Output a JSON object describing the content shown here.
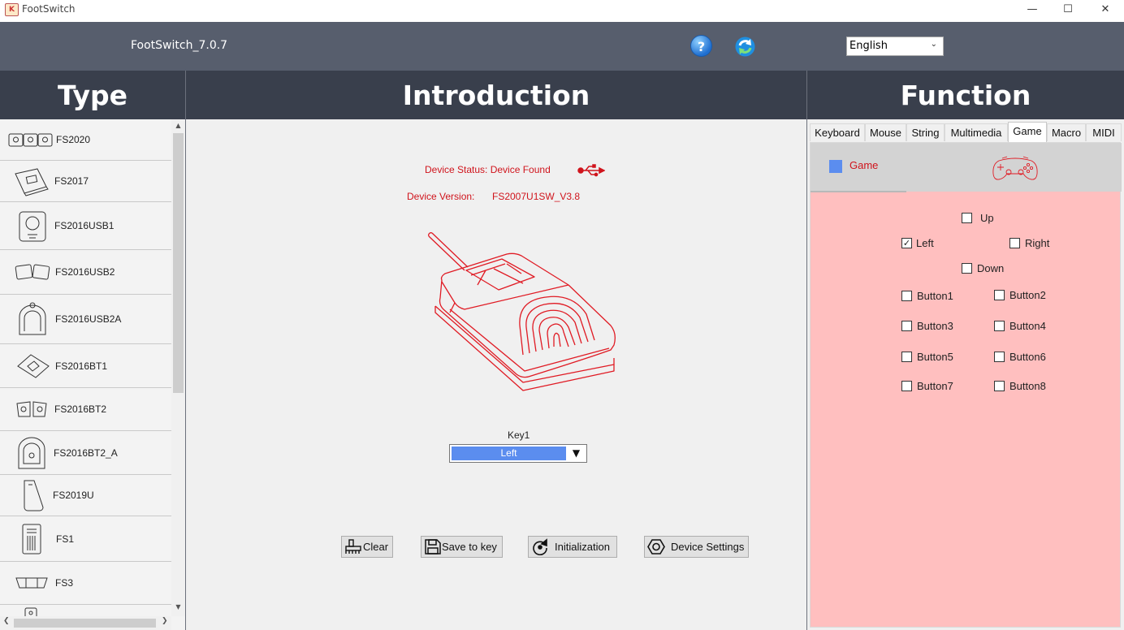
{
  "window": {
    "title": "FootSwitch",
    "app_icon_text": "K",
    "minimize": "—",
    "maximize": "☐",
    "close": "✕"
  },
  "header": {
    "version": "FootSwitch_7.0.7",
    "help_glyph": "?",
    "language": "English"
  },
  "columns": {
    "type": "Type",
    "introduction": "Introduction",
    "function": "Function"
  },
  "types": [
    "FS2020",
    "FS2017",
    "FS2016USB1",
    "FS2016USB2",
    "FS2016USB2A",
    "FS2016BT1",
    "FS2016BT2",
    "FS2016BT2_A",
    "FS2019U",
    "FS1",
    "FS3"
  ],
  "device": {
    "status": "Device Status: Device Found",
    "version_label": "Device Version:",
    "version_value": "FS2007U1SW_V3.8"
  },
  "key": {
    "label": "Key1",
    "value": "Left",
    "arrow": "▼"
  },
  "actions": {
    "clear": "Clear",
    "save": "Save to key",
    "init": "Initialization",
    "settings": "Device Settings"
  },
  "tabs": [
    "Keyboard",
    "Mouse",
    "String",
    "Multimedia",
    "Game",
    "Macro",
    "MIDI"
  ],
  "active_tab": "Game",
  "game": {
    "title": "Game",
    "options": {
      "up": {
        "label": "Up",
        "checked": false
      },
      "left": {
        "label": "Left",
        "checked": true
      },
      "right": {
        "label": "Right",
        "checked": false
      },
      "down": {
        "label": "Down",
        "checked": false
      },
      "button1": {
        "label": "Button1",
        "checked": false
      },
      "button2": {
        "label": "Button2",
        "checked": false
      },
      "button3": {
        "label": "Button3",
        "checked": false
      },
      "button4": {
        "label": "Button4",
        "checked": false
      },
      "button5": {
        "label": "Button5",
        "checked": false
      },
      "button6": {
        "label": "Button6",
        "checked": false
      },
      "button7": {
        "label": "Button7",
        "checked": false
      },
      "button8": {
        "label": "Button8",
        "checked": false
      }
    }
  },
  "colors": {
    "header": "#575e6d",
    "column_header": "#393f4c",
    "accent_red": "#d0141c",
    "select_blue": "#5b8def",
    "game_panel": "#ffbfbf"
  }
}
